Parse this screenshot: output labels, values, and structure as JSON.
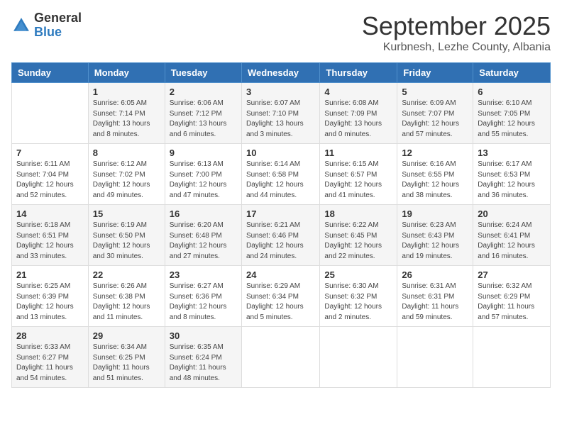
{
  "header": {
    "logo_general": "General",
    "logo_blue": "Blue",
    "month": "September 2025",
    "location": "Kurbnesh, Lezhe County, Albania"
  },
  "days_of_week": [
    "Sunday",
    "Monday",
    "Tuesday",
    "Wednesday",
    "Thursday",
    "Friday",
    "Saturday"
  ],
  "weeks": [
    [
      {
        "day": "",
        "info": ""
      },
      {
        "day": "1",
        "info": "Sunrise: 6:05 AM\nSunset: 7:14 PM\nDaylight: 13 hours\nand 8 minutes."
      },
      {
        "day": "2",
        "info": "Sunrise: 6:06 AM\nSunset: 7:12 PM\nDaylight: 13 hours\nand 6 minutes."
      },
      {
        "day": "3",
        "info": "Sunrise: 6:07 AM\nSunset: 7:10 PM\nDaylight: 13 hours\nand 3 minutes."
      },
      {
        "day": "4",
        "info": "Sunrise: 6:08 AM\nSunset: 7:09 PM\nDaylight: 13 hours\nand 0 minutes."
      },
      {
        "day": "5",
        "info": "Sunrise: 6:09 AM\nSunset: 7:07 PM\nDaylight: 12 hours\nand 57 minutes."
      },
      {
        "day": "6",
        "info": "Sunrise: 6:10 AM\nSunset: 7:05 PM\nDaylight: 12 hours\nand 55 minutes."
      }
    ],
    [
      {
        "day": "7",
        "info": "Sunrise: 6:11 AM\nSunset: 7:04 PM\nDaylight: 12 hours\nand 52 minutes."
      },
      {
        "day": "8",
        "info": "Sunrise: 6:12 AM\nSunset: 7:02 PM\nDaylight: 12 hours\nand 49 minutes."
      },
      {
        "day": "9",
        "info": "Sunrise: 6:13 AM\nSunset: 7:00 PM\nDaylight: 12 hours\nand 47 minutes."
      },
      {
        "day": "10",
        "info": "Sunrise: 6:14 AM\nSunset: 6:58 PM\nDaylight: 12 hours\nand 44 minutes."
      },
      {
        "day": "11",
        "info": "Sunrise: 6:15 AM\nSunset: 6:57 PM\nDaylight: 12 hours\nand 41 minutes."
      },
      {
        "day": "12",
        "info": "Sunrise: 6:16 AM\nSunset: 6:55 PM\nDaylight: 12 hours\nand 38 minutes."
      },
      {
        "day": "13",
        "info": "Sunrise: 6:17 AM\nSunset: 6:53 PM\nDaylight: 12 hours\nand 36 minutes."
      }
    ],
    [
      {
        "day": "14",
        "info": "Sunrise: 6:18 AM\nSunset: 6:51 PM\nDaylight: 12 hours\nand 33 minutes."
      },
      {
        "day": "15",
        "info": "Sunrise: 6:19 AM\nSunset: 6:50 PM\nDaylight: 12 hours\nand 30 minutes."
      },
      {
        "day": "16",
        "info": "Sunrise: 6:20 AM\nSunset: 6:48 PM\nDaylight: 12 hours\nand 27 minutes."
      },
      {
        "day": "17",
        "info": "Sunrise: 6:21 AM\nSunset: 6:46 PM\nDaylight: 12 hours\nand 24 minutes."
      },
      {
        "day": "18",
        "info": "Sunrise: 6:22 AM\nSunset: 6:45 PM\nDaylight: 12 hours\nand 22 minutes."
      },
      {
        "day": "19",
        "info": "Sunrise: 6:23 AM\nSunset: 6:43 PM\nDaylight: 12 hours\nand 19 minutes."
      },
      {
        "day": "20",
        "info": "Sunrise: 6:24 AM\nSunset: 6:41 PM\nDaylight: 12 hours\nand 16 minutes."
      }
    ],
    [
      {
        "day": "21",
        "info": "Sunrise: 6:25 AM\nSunset: 6:39 PM\nDaylight: 12 hours\nand 13 minutes."
      },
      {
        "day": "22",
        "info": "Sunrise: 6:26 AM\nSunset: 6:38 PM\nDaylight: 12 hours\nand 11 minutes."
      },
      {
        "day": "23",
        "info": "Sunrise: 6:27 AM\nSunset: 6:36 PM\nDaylight: 12 hours\nand 8 minutes."
      },
      {
        "day": "24",
        "info": "Sunrise: 6:29 AM\nSunset: 6:34 PM\nDaylight: 12 hours\nand 5 minutes."
      },
      {
        "day": "25",
        "info": "Sunrise: 6:30 AM\nSunset: 6:32 PM\nDaylight: 12 hours\nand 2 minutes."
      },
      {
        "day": "26",
        "info": "Sunrise: 6:31 AM\nSunset: 6:31 PM\nDaylight: 11 hours\nand 59 minutes."
      },
      {
        "day": "27",
        "info": "Sunrise: 6:32 AM\nSunset: 6:29 PM\nDaylight: 11 hours\nand 57 minutes."
      }
    ],
    [
      {
        "day": "28",
        "info": "Sunrise: 6:33 AM\nSunset: 6:27 PM\nDaylight: 11 hours\nand 54 minutes."
      },
      {
        "day": "29",
        "info": "Sunrise: 6:34 AM\nSunset: 6:25 PM\nDaylight: 11 hours\nand 51 minutes."
      },
      {
        "day": "30",
        "info": "Sunrise: 6:35 AM\nSunset: 6:24 PM\nDaylight: 11 hours\nand 48 minutes."
      },
      {
        "day": "",
        "info": ""
      },
      {
        "day": "",
        "info": ""
      },
      {
        "day": "",
        "info": ""
      },
      {
        "day": "",
        "info": ""
      }
    ]
  ]
}
